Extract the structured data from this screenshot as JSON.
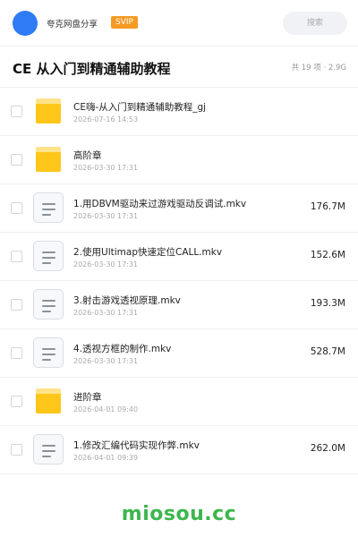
{
  "header": {
    "brand": "夸克网盘分享",
    "badge": "SVIP",
    "search_placeholder": "搜索"
  },
  "folder": {
    "title": "CE 从入门到精通辅助教程",
    "summary": "共 19 项 · 2.9G"
  },
  "items": [
    {
      "type": "folder",
      "icon": "folder-icon",
      "name": "CE嗨-从入门到精通辅助教程_gj",
      "date": "2026-07-16 14:53",
      "size": ""
    },
    {
      "type": "folder",
      "icon": "folder-icon",
      "name": "高阶章",
      "date": "2026-03-30 17:31",
      "size": ""
    },
    {
      "type": "file",
      "icon": "file-icon",
      "name": "1.用DBVM驱动来过游戏驱动反调试.mkv",
      "date": "2026-03-30 17:31",
      "size": "176.7M"
    },
    {
      "type": "file",
      "icon": "file-icon",
      "name": "2.使用Ultimap快速定位CALL.mkv",
      "date": "2026-03-30 17:31",
      "size": "152.6M"
    },
    {
      "type": "file",
      "icon": "file-icon",
      "name": "3.射击游戏透视原理.mkv",
      "date": "2026-03-30 17:31",
      "size": "193.3M"
    },
    {
      "type": "file",
      "icon": "file-icon",
      "name": "4.透视方框的制作.mkv",
      "date": "2026-03-30 17:31",
      "size": "528.7M"
    },
    {
      "type": "folder",
      "icon": "folder-icon",
      "name": "进阶章",
      "date": "2026-04-01 09:40",
      "size": ""
    },
    {
      "type": "file",
      "icon": "file-icon",
      "name": "1.修改汇编代码实现作弊.mkv",
      "date": "2026-04-01 09:39",
      "size": "262.0M"
    }
  ],
  "watermark": "miosou.cc",
  "colors": {
    "accent_blue": "#2f7bf6",
    "svip_orange": "#f59a23",
    "folder_yellow": "#ffc61a",
    "watermark_green": "#3cb64c"
  }
}
